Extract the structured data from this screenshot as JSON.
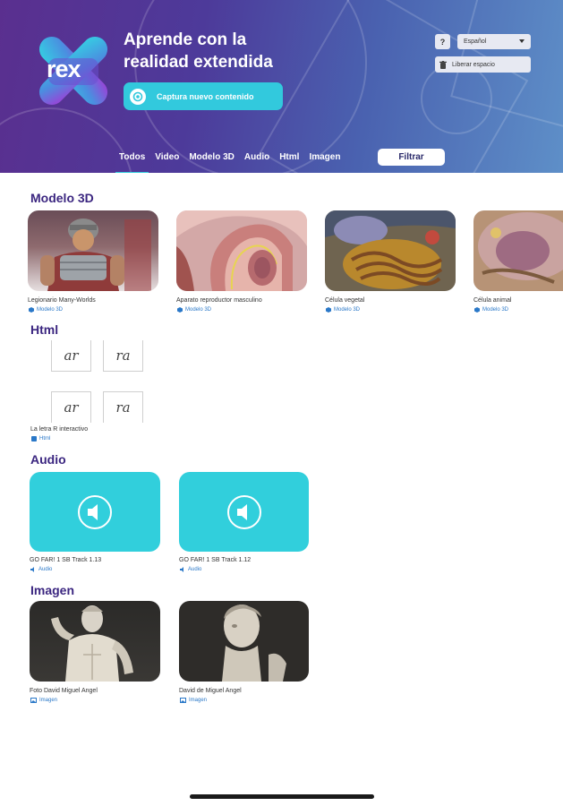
{
  "header": {
    "logo_text": "rex",
    "headline_line1": "Aprende con la",
    "headline_line2": "realidad extendida",
    "capture_label": "Captura nuevo contenido",
    "help_label": "?",
    "language": "Español",
    "free_space_label": "Liberar espacio",
    "tabs": [
      "Todos",
      "Video",
      "Modelo 3D",
      "Audio",
      "Html",
      "Imagen"
    ],
    "active_tab": "Todos",
    "filter_label": "Filtrar",
    "accent_color": "#32c9dd"
  },
  "sections": {
    "model3d": {
      "title": "Modelo 3D",
      "items": [
        {
          "title": "Legionario Many-Worlds",
          "type": "Modelo 3D"
        },
        {
          "title": "Aparato reproductor masculino",
          "type": "Modelo 3D"
        },
        {
          "title": "Célula vegetal",
          "type": "Modelo 3D"
        },
        {
          "title": "Célula animal",
          "type": "Modelo 3D"
        }
      ]
    },
    "html": {
      "title": "Html",
      "tiles": [
        "ar",
        "ra",
        "ar",
        "ra"
      ],
      "items": [
        {
          "title": "La letra R interactivo",
          "type": "Html"
        }
      ]
    },
    "audio": {
      "title": "Audio",
      "items": [
        {
          "title": "GO FAR! 1 SB Track 1.13",
          "type": "Audio"
        },
        {
          "title": "GO FAR! 1 SB Track 1.12",
          "type": "Audio"
        }
      ]
    },
    "imagen": {
      "title": "Imagen",
      "items": [
        {
          "title": "Foto David Miguel Angel",
          "type": "Imagen"
        },
        {
          "title": "David de Miguel Angel",
          "type": "Imagen"
        }
      ]
    }
  }
}
